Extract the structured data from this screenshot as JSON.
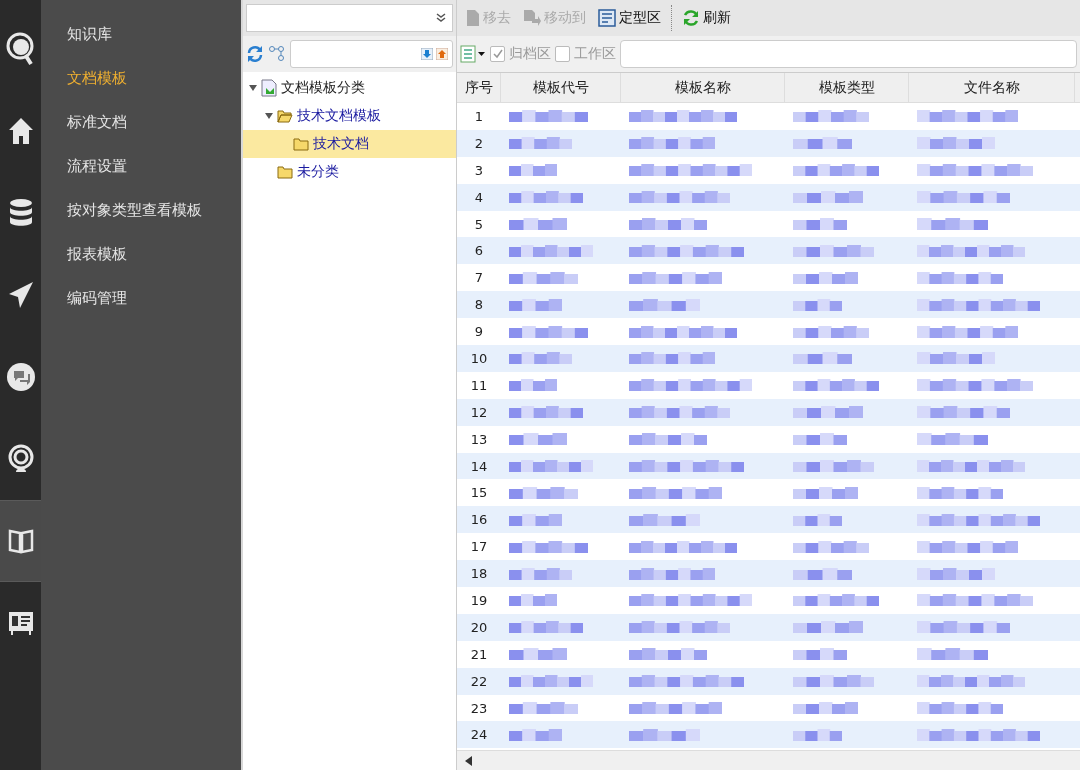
{
  "icon_bar": [
    {
      "kind": "search-logo",
      "selected": false
    },
    {
      "kind": "home",
      "selected": false
    },
    {
      "kind": "database",
      "selected": false
    },
    {
      "kind": "send",
      "selected": false
    },
    {
      "kind": "chat",
      "selected": false
    },
    {
      "kind": "broadcast",
      "selected": false
    },
    {
      "kind": "book",
      "selected": true
    },
    {
      "kind": "card",
      "selected": false
    }
  ],
  "menu": {
    "items": [
      {
        "label": "知识库",
        "selected": false
      },
      {
        "label": "文档模板",
        "selected": true
      },
      {
        "label": "标准文档",
        "selected": false
      },
      {
        "label": "流程设置",
        "selected": false
      },
      {
        "label": "按对象类型查看模板",
        "selected": false
      },
      {
        "label": "报表模板",
        "selected": false
      },
      {
        "label": "编码管理",
        "selected": false
      }
    ]
  },
  "tree": {
    "root": {
      "label": "文档模板分类",
      "expanded": true,
      "selected": false,
      "children": [
        {
          "label": "技术文档模板",
          "expanded": true,
          "selected": false,
          "children": [
            {
              "label": "技术文档",
              "selected": true
            }
          ]
        },
        {
          "label": "未分类",
          "selected": false
        }
      ]
    }
  },
  "toolbar": [
    {
      "kind": "remove",
      "label": "移去",
      "disabled": true
    },
    {
      "kind": "move",
      "label": "移动到",
      "disabled": true
    },
    {
      "kind": "finalize",
      "label": "定型区",
      "disabled": false
    },
    {
      "kind": "refresh",
      "label": "刷新",
      "disabled": false
    }
  ],
  "filters": [
    {
      "label": "归档区",
      "checked": true
    },
    {
      "label": "工作区",
      "checked": false
    }
  ],
  "table": {
    "columns": [
      "序号",
      "模板代号",
      "模板名称",
      "模板类型",
      "文件名称"
    ],
    "rows": [
      "1",
      "2",
      "3",
      "4",
      "5",
      "6",
      "7",
      "8",
      "9",
      "10",
      "11",
      "12",
      "13",
      "14",
      "15",
      "16",
      "17",
      "18",
      "19",
      "20",
      "21",
      "22",
      "23",
      "24"
    ]
  }
}
